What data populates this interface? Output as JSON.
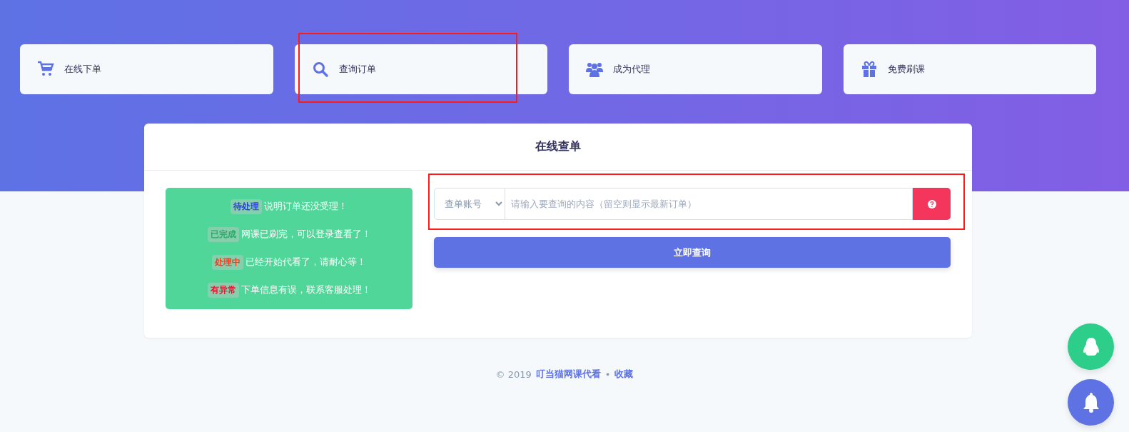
{
  "nav": [
    {
      "label": "在线下单",
      "kind": "cart",
      "highlighted": false
    },
    {
      "label": "查询订单",
      "kind": "search",
      "highlighted": true
    },
    {
      "label": "成为代理",
      "kind": "users",
      "highlighted": false
    },
    {
      "label": "免费刷课",
      "kind": "gift",
      "highlighted": false
    }
  ],
  "panel": {
    "title": "在线查单",
    "legend": [
      {
        "badge": "待处理",
        "kind": "pending",
        "text": "说明订单还没受理！"
      },
      {
        "badge": "已完成",
        "kind": "done",
        "text": "网课已刷完，可以登录查看了！"
      },
      {
        "badge": "处理中",
        "kind": "processing",
        "text": "已经开始代看了，请耐心等！"
      },
      {
        "badge": "有异常",
        "kind": "error",
        "text": "下单信息有误，联系客服处理！"
      }
    ],
    "search": {
      "select": "查单账号",
      "placeholder": "请输入要查询的内容（留空则显示最新订单）",
      "highlighted": true
    },
    "submit": "立即查询"
  },
  "footer": {
    "copyright": "© 2019",
    "site_link": "叮当猫网课代看",
    "separator": "•",
    "bookmark_link": "收藏"
  }
}
